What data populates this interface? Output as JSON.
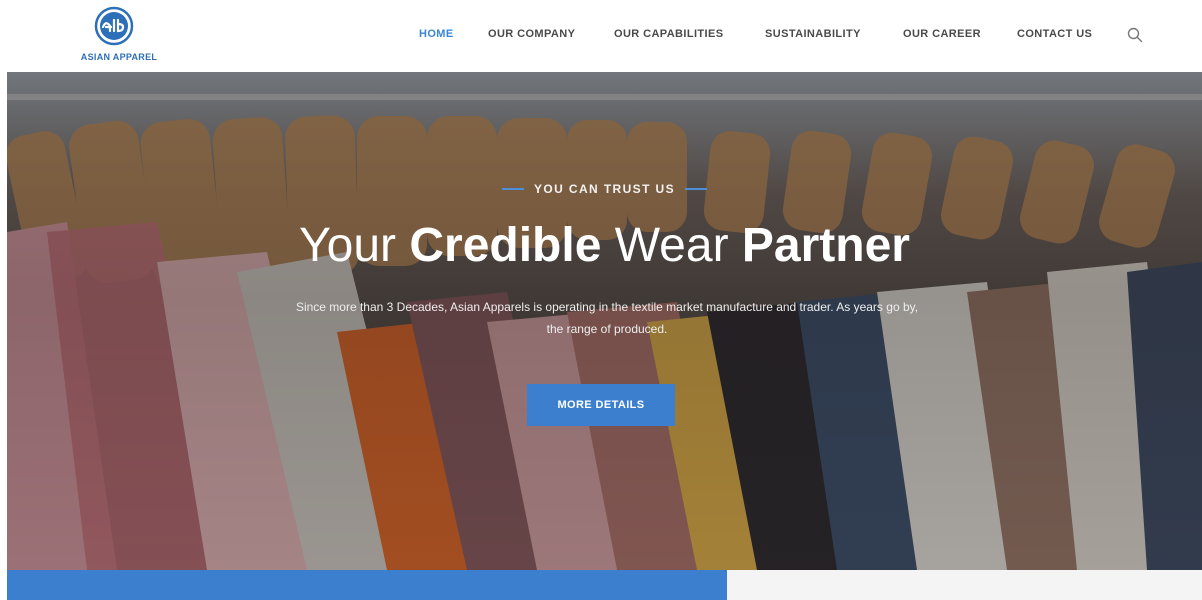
{
  "brand": {
    "logo_text": "ASIAN APPAREL",
    "logo_color": "#2d6fb8"
  },
  "nav": {
    "items": [
      {
        "label": "HOME",
        "active": true
      },
      {
        "label": "OUR COMPANY",
        "active": false
      },
      {
        "label": "OUR CAPABILITIES",
        "active": false
      },
      {
        "label": "SUSTAINABILITY",
        "active": false
      },
      {
        "label": "OUR CAREER",
        "active": false
      },
      {
        "label": "CONTACT US",
        "active": false
      }
    ],
    "search_icon": "search-icon",
    "active_color": "#3a86d4"
  },
  "hero": {
    "eyebrow": "YOU CAN TRUST US",
    "title_part1": "Your ",
    "title_part2": "Credible",
    "title_part3": " Wear ",
    "title_part4": "Partner",
    "description": "Since more than 3 Decades, Asian Apparels is operating in the textile market manufacture and trader. As years go by, the range of produced.",
    "cta_label": "MORE DETAILS",
    "accent_color": "#3c7fcf",
    "background_image": "clothes-on-hangers-photo"
  }
}
